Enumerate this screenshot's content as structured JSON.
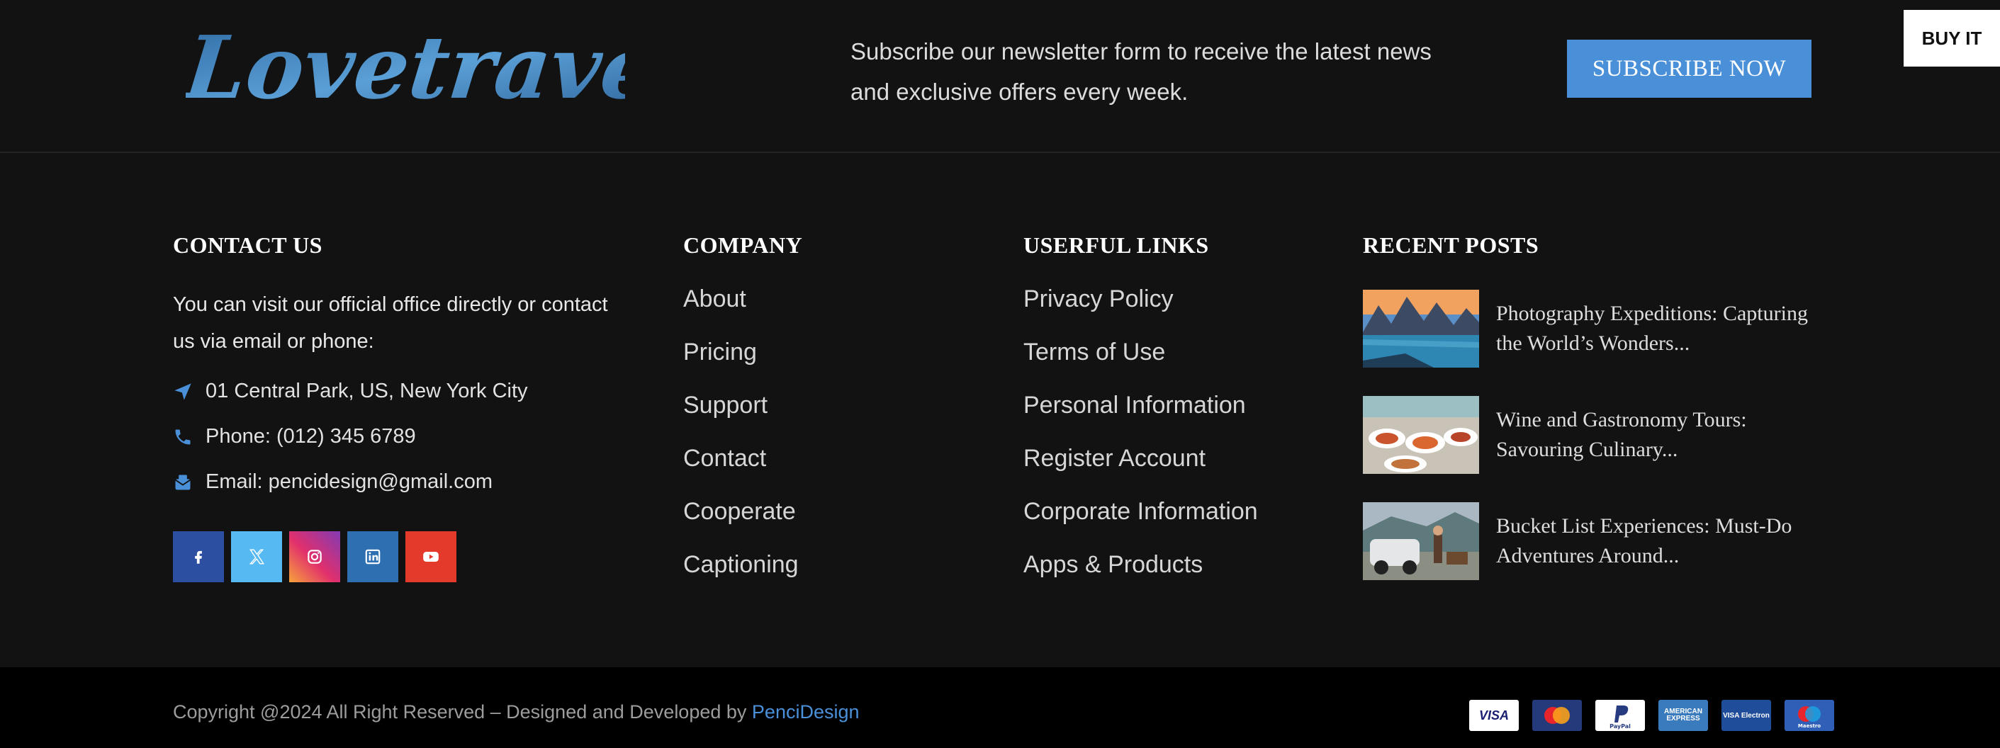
{
  "brand": {
    "logo_text": "Lovetravel",
    "accent_color": "#4a90d9"
  },
  "newsletter": {
    "text": "Subscribe our newsletter form to receive the latest news and exclusive offers every week.",
    "button_label": "SUBSCRIBE NOW"
  },
  "buy_it_label": "BUY IT",
  "contact": {
    "heading": "CONTACT US",
    "description": "You can visit our official office directly or contact us via email or phone:",
    "address": "01 Central Park, US, New York City",
    "phone": "Phone: (012) 345 6789",
    "email": "Email: pencidesign@gmail.com",
    "socials": [
      {
        "icon": "facebook-icon",
        "color": "#2d4fa2"
      },
      {
        "icon": "x-icon",
        "color": "#56b9f2"
      },
      {
        "icon": "instagram-icon",
        "color": "#e1306c"
      },
      {
        "icon": "linkedin-icon",
        "color": "#2e6fb1"
      },
      {
        "icon": "youtube-icon",
        "color": "#e43a2b"
      }
    ]
  },
  "company": {
    "heading": "COMPANY",
    "links": [
      "About",
      "Pricing",
      "Support",
      "Contact",
      "Cooperate",
      "Captioning"
    ]
  },
  "useful_links": {
    "heading": "USERFUL LINKS",
    "links": [
      "Privacy Policy",
      "Terms of Use",
      "Personal Information",
      "Register Account",
      "Corporate Information",
      "Apps & Products"
    ]
  },
  "recent_posts": {
    "heading": "RECENT POSTS",
    "posts": [
      {
        "title": "Photography Expeditions: Capturing the World’s Wonders..."
      },
      {
        "title": "Wine and Gastronomy Tours: Savouring Culinary..."
      },
      {
        "title": "Bucket List Experiences: Must-Do Adventures Around..."
      }
    ]
  },
  "footer": {
    "copyright_prefix": "Copyright @2024  All Right Reserved – Designed and Developed by",
    "copyright_brand": "PenciDesign",
    "payment_methods": [
      {
        "icon": "visa-icon",
        "label": "VISA"
      },
      {
        "icon": "mastercard-icon"
      },
      {
        "icon": "paypal-icon",
        "label": "PayPal"
      },
      {
        "icon": "american-express-icon",
        "label": "AMERICAN EXPRESS"
      },
      {
        "icon": "visa-electron-icon",
        "label": "VISA Electron"
      },
      {
        "icon": "maestro-icon",
        "label": "Maestro"
      }
    ]
  }
}
